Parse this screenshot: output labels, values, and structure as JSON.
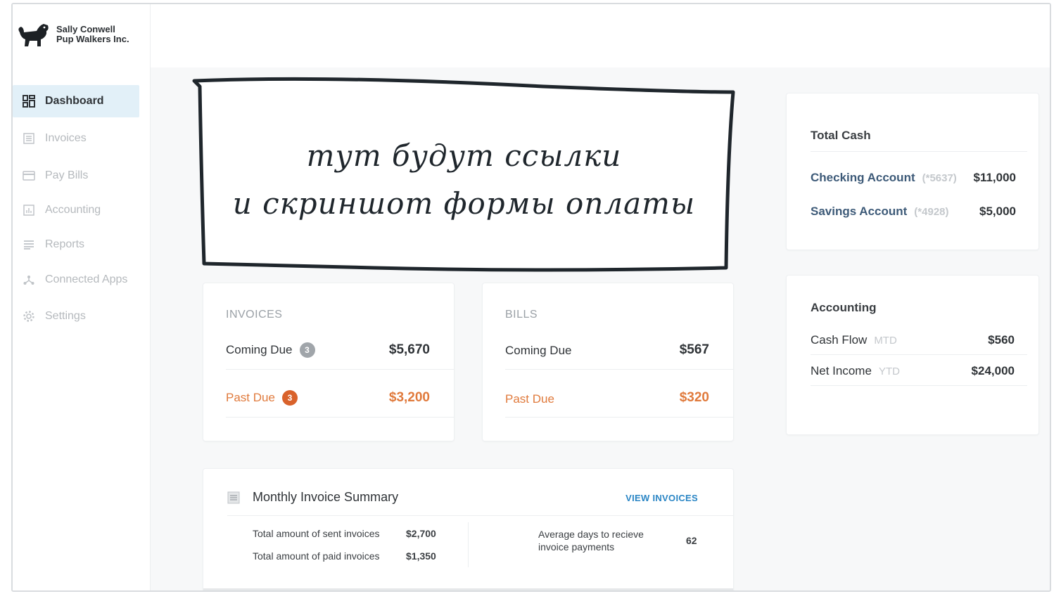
{
  "brand": {
    "line1": "Sally Conwell",
    "line2": "Pup Walkers Inc."
  },
  "sidebar": {
    "items": [
      {
        "label": "Dashboard",
        "icon": "dashboard-icon",
        "active": true
      },
      {
        "label": "Invoices",
        "icon": "invoice-icon"
      },
      {
        "label": "Pay Bills",
        "icon": "card-icon"
      },
      {
        "label": "Accounting",
        "icon": "chart-icon"
      },
      {
        "label": "Reports",
        "icon": "list-icon"
      },
      {
        "label": "Connected Apps",
        "icon": "network-icon"
      },
      {
        "label": "Settings",
        "icon": "gear-icon"
      }
    ]
  },
  "note": {
    "line1": "тут будут ссылки",
    "line2": "и скриншот формы оплаты"
  },
  "invoices": {
    "title": "INVOICES",
    "coming_due_label": "Coming Due",
    "coming_due_count": "3",
    "coming_due_amount": "$5,670",
    "past_due_label": "Past Due",
    "past_due_count": "3",
    "past_due_amount": "$3,200"
  },
  "bills": {
    "title": "BILLS",
    "coming_due_label": "Coming Due",
    "coming_due_amount": "$567",
    "past_due_label": "Past Due",
    "past_due_amount": "$320"
  },
  "summary": {
    "title": "Monthly Invoice Summary",
    "link": "VIEW INVOICES",
    "sent_label": "Total amount of sent invoices",
    "sent_value": "$2,700",
    "paid_label": "Total amount of paid invoices",
    "paid_value": "$1,350",
    "avg_label_1": "Average days to recieve",
    "avg_label_2": "invoice payments",
    "avg_value": "62"
  },
  "total_cash": {
    "title": "Total Cash",
    "checking_label": "Checking Account",
    "checking_mask": "(*5637)",
    "checking_value": "$11,000",
    "savings_label": "Savings Account",
    "savings_mask": "(*4928)",
    "savings_value": "$5,000"
  },
  "accounting": {
    "title": "Accounting",
    "cashflow_label": "Cash Flow",
    "cashflow_period": "MTD",
    "cashflow_value": "$560",
    "netincome_label": "Net Income",
    "netincome_period": "YTD",
    "netincome_value": "$24,000"
  },
  "colors": {
    "accent": "#2b86c5",
    "warning": "#e07a3c",
    "active_bg": "#e2f0f8"
  }
}
